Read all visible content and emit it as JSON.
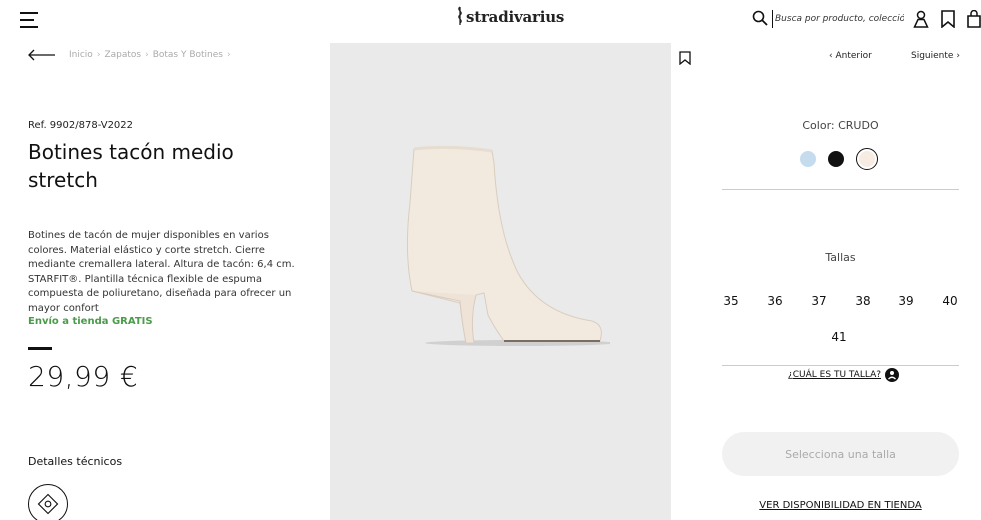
{
  "header": {
    "logo": "stradivarius",
    "search_placeholder": "Busca por producto, colección..."
  },
  "breadcrumb": [
    "Inicio",
    "Zapatos",
    "Botas Y Botines"
  ],
  "product": {
    "ref": "Ref. 9902/878-V2022",
    "title": "Botines tacón medio stretch",
    "description": "Botines de tacón de mujer disponibles en varios colores. Material elástico y corte stretch. Cierre mediante cremallera lateral. Altura de tacón: 6,4 cm. STARFIT®. Plantilla técnica flexible de espuma compuesta de poliuretano, diseñada para ofrecer un mayor confort",
    "shipping": "Envío a tienda GRATIS",
    "price": "29,99 €",
    "details_title": "Detalles técnicos"
  },
  "nav": {
    "prev": "Anterior",
    "next": "Siguiente"
  },
  "color": {
    "label": "Color: CRUDO",
    "swatches": [
      {
        "name": "Azul claro",
        "hex": "#c5dbee"
      },
      {
        "name": "Negro",
        "hex": "#111111"
      },
      {
        "name": "Crudo",
        "hex": "#f6ece2",
        "selected": true
      }
    ]
  },
  "sizes": {
    "label": "Tallas",
    "values": [
      "35",
      "36",
      "37",
      "38",
      "39",
      "40",
      "41"
    ],
    "guide": "¿CUÁL ES TU TALLA?"
  },
  "actions": {
    "select_size": "Selecciona una talla",
    "availability": "VER DISPONIBILIDAD EN TIENDA"
  },
  "colors": {
    "shipping": "#4a9b4a",
    "image_bg": "#eaeaea"
  }
}
